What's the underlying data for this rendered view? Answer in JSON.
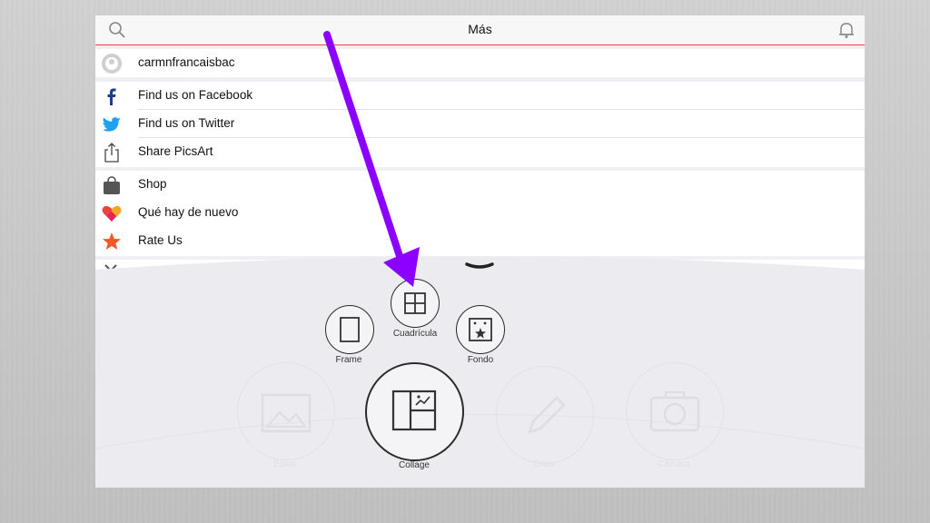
{
  "header": {
    "title": "Más"
  },
  "profile": {
    "username": "carmnfrancaisbac"
  },
  "social": {
    "facebook": "Find us on Facebook",
    "twitter": "Find us on Twitter",
    "share": "Share PicsArt"
  },
  "extras": {
    "shop": "Shop",
    "whats_new": "Qué hay de nuevo",
    "rate": "Rate Us"
  },
  "create_menu": {
    "grid": "Cuadrícula",
    "frame": "Frame",
    "background": "Fondo",
    "collage": "Collage",
    "faded": {
      "edit": "Editar",
      "draw": "Draw",
      "camera": "Cámara"
    }
  },
  "colors": {
    "accent": "#e8453c",
    "annotation_arrow": "#8b00ff",
    "twitter": "#1da1f2",
    "facebook": "#3b5998"
  }
}
